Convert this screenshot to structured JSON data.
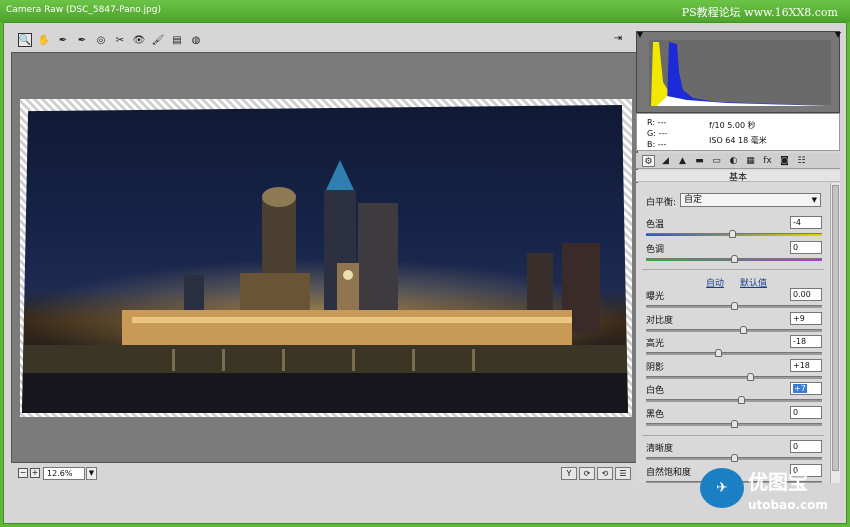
{
  "window": {
    "title": "Camera Raw (DSC_5847-Pano.jpg)",
    "watermark": "PS教程论坛 www.16XX8.com"
  },
  "toolbar": {
    "tools": [
      {
        "name": "zoom-tool",
        "icon": "🔍"
      },
      {
        "name": "hand-tool",
        "icon": "✋"
      },
      {
        "name": "white-balance-tool",
        "icon": "✒"
      },
      {
        "name": "color-sampler-tool",
        "icon": "✒"
      },
      {
        "name": "targeted-adjustment-tool",
        "icon": "◎"
      },
      {
        "name": "crop-tool",
        "icon": "✂"
      },
      {
        "name": "red-eye-tool",
        "icon": "👁"
      },
      {
        "name": "adjustment-brush-tool",
        "icon": "🖌"
      },
      {
        "name": "graduated-filter-tool",
        "icon": "▤"
      },
      {
        "name": "radial-filter-tool",
        "icon": "◍"
      }
    ],
    "export_icon": "⇥"
  },
  "statusbar": {
    "zoom_out": "−",
    "zoom_in": "+",
    "zoom_level": "12.6%",
    "dropdown_arrow": "▼",
    "view_buttons": [
      "Y",
      "⟳",
      "⟲",
      "☰"
    ]
  },
  "info": {
    "r": "R:  ---",
    "g": "G:  ---",
    "b": "B:  ---",
    "aperture_shutter": "f/10   5.00 秒",
    "iso_focal": "ISO 64   18 毫米"
  },
  "tabs": [
    "⚙",
    "◢",
    "▲",
    "▬",
    "▭",
    "◐",
    "▦",
    "fx",
    "◙",
    "☷"
  ],
  "panel": {
    "section_title": "基本",
    "white_balance_label": "白平衡:",
    "white_balance_value": "自定",
    "auto_link": "自动",
    "default_link": "默认值",
    "sliders_top": [
      {
        "label": "色温",
        "value": "-4",
        "pos": 0.49
      },
      {
        "label": "色调",
        "value": "0",
        "pos": 0.5
      }
    ],
    "sliders_main": [
      {
        "label": "曝光",
        "value": "0.00",
        "pos": 0.5
      },
      {
        "label": "对比度",
        "value": "+9",
        "pos": 0.55
      },
      {
        "label": "高光",
        "value": "-18",
        "pos": 0.41
      },
      {
        "label": "阴影",
        "value": "+18",
        "pos": 0.59
      },
      {
        "label": "白色",
        "value": "+7",
        "pos": 0.54
      },
      {
        "label": "黑色",
        "value": "0",
        "pos": 0.5
      }
    ],
    "sliders_presence": [
      {
        "label": "清晰度",
        "value": "0",
        "pos": 0.5
      },
      {
        "label": "自然饱和度",
        "value": "0",
        "pos": 0.5
      }
    ]
  },
  "logo": {
    "name": "优图宝",
    "url": "utobao.com"
  },
  "colors": {
    "window_accent": "#5fb83a",
    "histogram_yellow": "#f0e800",
    "histogram_blue": "#1c2ad8",
    "temp_gradient_left": "#2a55d0",
    "temp_gradient_right": "#e6d400",
    "tint_gradient_left": "#2fae3a",
    "tint_gradient_right": "#b23bd0"
  }
}
